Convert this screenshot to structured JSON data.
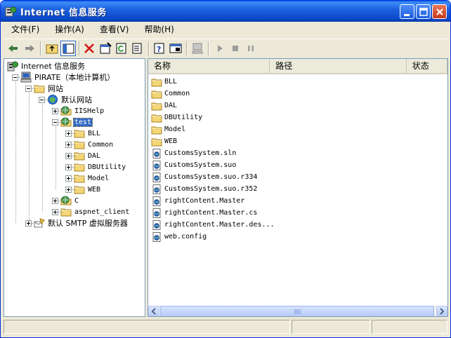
{
  "window": {
    "title": "Internet 信息服务"
  },
  "menu": [
    "文件(F)",
    "操作(A)",
    "查看(V)",
    "帮助(H)"
  ],
  "tree": [
    {
      "label": "Internet 信息服务",
      "level": 0,
      "icon": "iis-icon",
      "cjk": true
    },
    {
      "label": "PIRATE（本地计算机）",
      "level": 1,
      "icon": "computer-icon",
      "expander": "minus",
      "cjk": true
    },
    {
      "label": "网站",
      "level": 2,
      "icon": "folder-icon",
      "expander": "minus",
      "cjk": true
    },
    {
      "label": "默认网站",
      "level": 3,
      "icon": "website-icon",
      "expander": "minus",
      "cjk": true
    },
    {
      "label": "IISHelp",
      "level": 4,
      "icon": "globe-folder-icon",
      "expander": "plus"
    },
    {
      "label": "test",
      "level": 4,
      "icon": "globe-folder-icon",
      "expander": "minus",
      "selected": true
    },
    {
      "label": "BLL",
      "level": 5,
      "icon": "folder-icon",
      "expander": "plus"
    },
    {
      "label": "Common",
      "level": 5,
      "icon": "folder-icon",
      "expander": "plus"
    },
    {
      "label": "DAL",
      "level": 5,
      "icon": "folder-icon",
      "expander": "plus"
    },
    {
      "label": "DBUtility",
      "level": 5,
      "icon": "folder-icon",
      "expander": "plus"
    },
    {
      "label": "Model",
      "level": 5,
      "icon": "folder-icon",
      "expander": "plus"
    },
    {
      "label": "WEB",
      "level": 5,
      "icon": "folder-icon",
      "expander": "plus"
    },
    {
      "label": "C",
      "level": 4,
      "icon": "globe-folder-icon",
      "expander": "plus"
    },
    {
      "label": "aspnet_client",
      "level": 4,
      "icon": "folder-icon",
      "expander": "plus"
    },
    {
      "label": "默认 SMTP 虚拟服务器",
      "level": 2,
      "icon": "smtp-icon",
      "expander": "plus",
      "cjk": true
    }
  ],
  "list": {
    "columns": [
      "名称",
      "路径",
      "状态"
    ],
    "items": [
      {
        "name": "BLL",
        "icon": "folder-icon"
      },
      {
        "name": "Common",
        "icon": "folder-icon"
      },
      {
        "name": "DAL",
        "icon": "folder-icon"
      },
      {
        "name": "DBUtility",
        "icon": "folder-icon"
      },
      {
        "name": "Model",
        "icon": "folder-icon"
      },
      {
        "name": "WEB",
        "icon": "folder-icon"
      },
      {
        "name": "CustomsSystem.sln",
        "icon": "file-icon"
      },
      {
        "name": "CustomsSystem.suo",
        "icon": "file-icon"
      },
      {
        "name": "CustomsSystem.suo.r334",
        "icon": "file-icon"
      },
      {
        "name": "CustomsSystem.suo.r352",
        "icon": "file-icon"
      },
      {
        "name": "rightContent.Master",
        "icon": "file-icon"
      },
      {
        "name": "rightContent.Master.cs",
        "icon": "file-icon"
      },
      {
        "name": "rightContent.Master.des...",
        "icon": "file-icon"
      },
      {
        "name": "web.config",
        "icon": "file-icon"
      }
    ]
  },
  "colors": {
    "selection": "#316ac5",
    "titlebar": "#0a48c8",
    "folder": "#f4d675"
  }
}
